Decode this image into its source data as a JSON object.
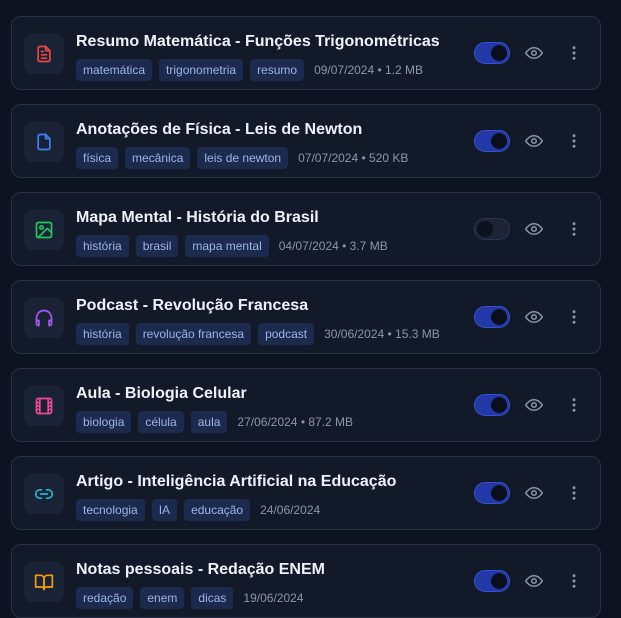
{
  "items": [
    {
      "title": "Resumo Matemática - Funções Trigonométricas",
      "tags": [
        "matemática",
        "trigonometria",
        "resumo"
      ],
      "info": "09/07/2024 • 1.2 MB",
      "icon": "document-text-icon",
      "icon_color": "#ef4444",
      "visible": true
    },
    {
      "title": "Anotações de Física - Leis de Newton",
      "tags": [
        "física",
        "mecânica",
        "leis de newton"
      ],
      "info": "07/07/2024 • 520 KB",
      "icon": "document-icon",
      "icon_color": "#3b82f6",
      "visible": true
    },
    {
      "title": "Mapa Mental - História do Brasil",
      "tags": [
        "história",
        "brasil",
        "mapa mental"
      ],
      "info": "04/07/2024 • 3.7 MB",
      "icon": "image-icon",
      "icon_color": "#22c55e",
      "visible": false
    },
    {
      "title": "Podcast - Revolução Francesa",
      "tags": [
        "história",
        "revolução francesa",
        "podcast"
      ],
      "info": "30/06/2024 • 15.3 MB",
      "icon": "headphones-icon",
      "icon_color": "#a855f7",
      "visible": true
    },
    {
      "title": "Aula - Biologia Celular",
      "tags": [
        "biologia",
        "célula",
        "aula"
      ],
      "info": "27/06/2024 • 87.2 MB",
      "icon": "film-icon",
      "icon_color": "#ec4899",
      "visible": true
    },
    {
      "title": "Artigo - Inteligência Artificial na Educação",
      "tags": [
        "tecnologia",
        "IA",
        "educação"
      ],
      "info": "24/06/2024",
      "icon": "link-icon",
      "icon_color": "#22b8cf",
      "visible": true
    },
    {
      "title": "Notas pessoais - Redação ENEM",
      "tags": [
        "redação",
        "enem",
        "dicas"
      ],
      "info": "19/06/2024",
      "icon": "book-open-icon",
      "icon_color": "#f59e0b",
      "visible": true
    }
  ]
}
